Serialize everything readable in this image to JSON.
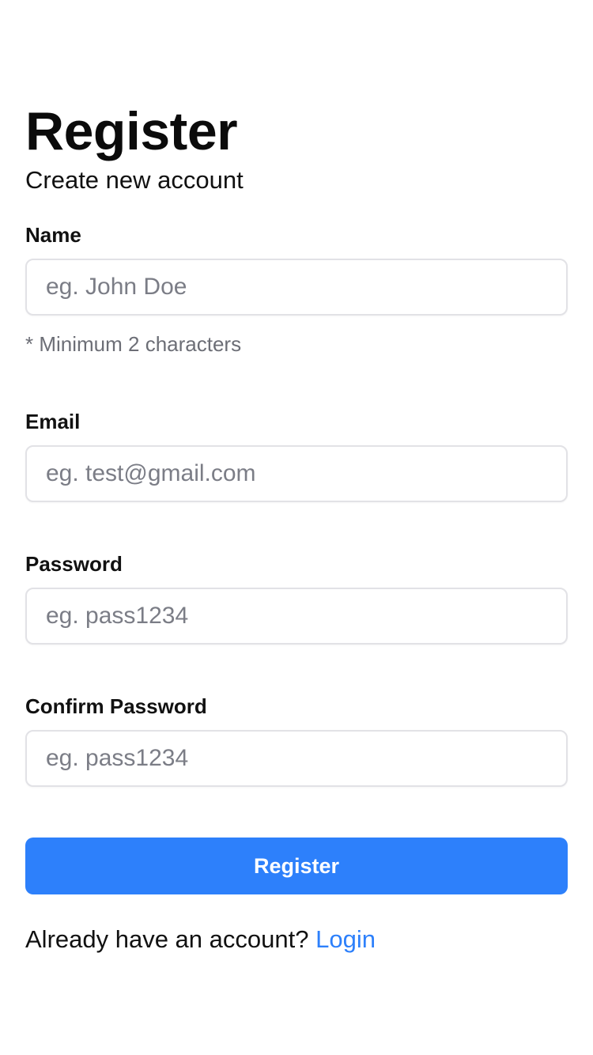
{
  "header": {
    "title": "Register",
    "subtitle": "Create new account"
  },
  "form": {
    "name": {
      "label": "Name",
      "placeholder": "eg. John Doe",
      "value": "",
      "hint": "* Minimum 2 characters"
    },
    "email": {
      "label": "Email",
      "placeholder": "eg. test@gmail.com",
      "value": ""
    },
    "password": {
      "label": "Password",
      "placeholder": "eg. pass1234",
      "value": ""
    },
    "confirm_password": {
      "label": "Confirm Password",
      "placeholder": "eg. pass1234",
      "value": ""
    },
    "submit_label": "Register"
  },
  "footer": {
    "prompt": "Already have an account?",
    "link_label": "Login"
  },
  "colors": {
    "accent": "#2d80fb",
    "placeholder": "#7b7d86",
    "hint": "#6c6e76",
    "border": "#e2e2e6"
  }
}
